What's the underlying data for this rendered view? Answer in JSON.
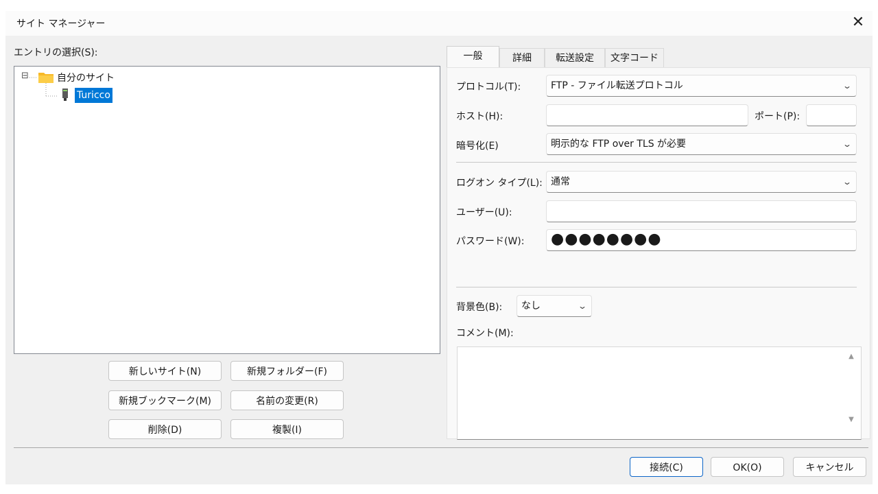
{
  "window": {
    "title": "サイト マネージャー",
    "close_glyph": "✕"
  },
  "left": {
    "entry_label": "エントリの選択(S):",
    "tree": {
      "expander": "⊟",
      "root_label": "自分のサイト",
      "child_label": "Turicco"
    },
    "buttons": {
      "new_site": "新しいサイト(N)",
      "new_folder": "新規フォルダー(F)",
      "new_bookmark": "新規ブックマーク(M)",
      "rename": "名前の変更(R)",
      "delete": "削除(D)",
      "duplicate": "複製(I)"
    }
  },
  "tabs": [
    {
      "label": "一般"
    },
    {
      "label": "詳細"
    },
    {
      "label": "転送設定"
    },
    {
      "label": "文字コード"
    }
  ],
  "general": {
    "protocol": {
      "label": "プロトコル(T):",
      "value": "FTP - ファイル転送プロトコル"
    },
    "host": {
      "label": "ホスト(H):",
      "value": ""
    },
    "port": {
      "label": "ポート(P):",
      "value": ""
    },
    "encryption": {
      "label": "暗号化(E)",
      "value": "明示的な FTP over TLS が必要"
    },
    "logon_type": {
      "label": "ログオン タイプ(L):",
      "value": "通常"
    },
    "user": {
      "label": "ユーザー(U):",
      "value": ""
    },
    "password": {
      "label": "パスワード(W):",
      "value": "●●●●●●●●"
    },
    "bgcolor": {
      "label": "背景色(B):",
      "value": "なし"
    },
    "comment": {
      "label": "コメント(M):",
      "value": ""
    }
  },
  "footer": {
    "connect": "接続(C)",
    "ok": "OK(O)",
    "cancel": "キャンセル"
  },
  "icons": {
    "dropdown": "chevron-down-icon",
    "folder": "folder-icon",
    "server": "server-icon",
    "scroll_up": "▲",
    "scroll_down": "▼"
  },
  "colors": {
    "selection": "#0078d7",
    "folder": "#f7b928",
    "default_button_border": "#0a64c8"
  }
}
